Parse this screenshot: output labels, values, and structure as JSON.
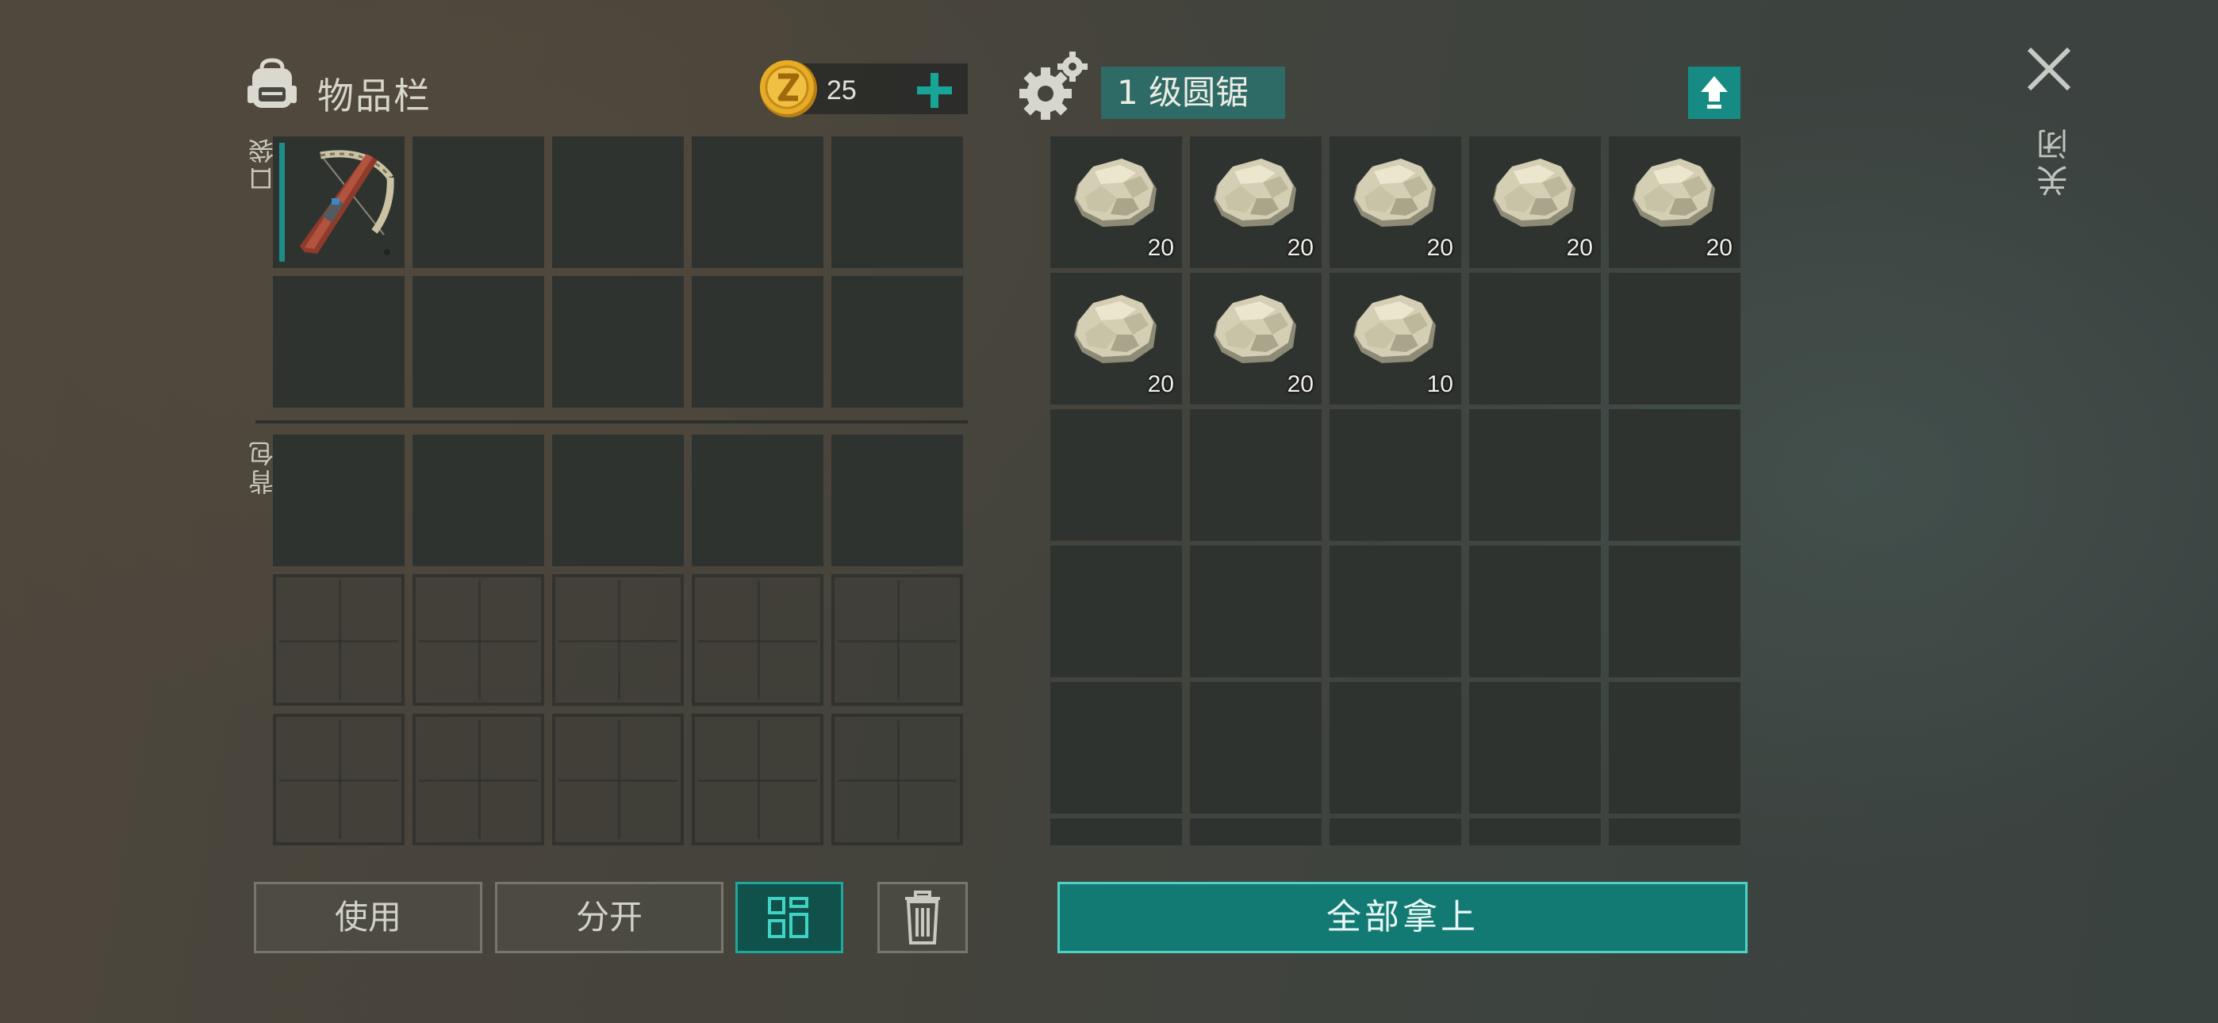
{
  "inventory": {
    "title": "物品栏",
    "coins": "25",
    "pocket_label": "口袋",
    "backpack_label": "背包"
  },
  "machine": {
    "title": "1 级圆锯",
    "stone_quantities": [
      "20",
      "20",
      "20",
      "20",
      "20",
      "20",
      "20",
      "10"
    ]
  },
  "buttons": {
    "use": "使用",
    "split": "分开",
    "take_all": "全部拿上",
    "close": "关闭"
  },
  "colors": {
    "accent": "#158b84",
    "slot": "#2f3330",
    "title_bar": "#2e6a66"
  }
}
